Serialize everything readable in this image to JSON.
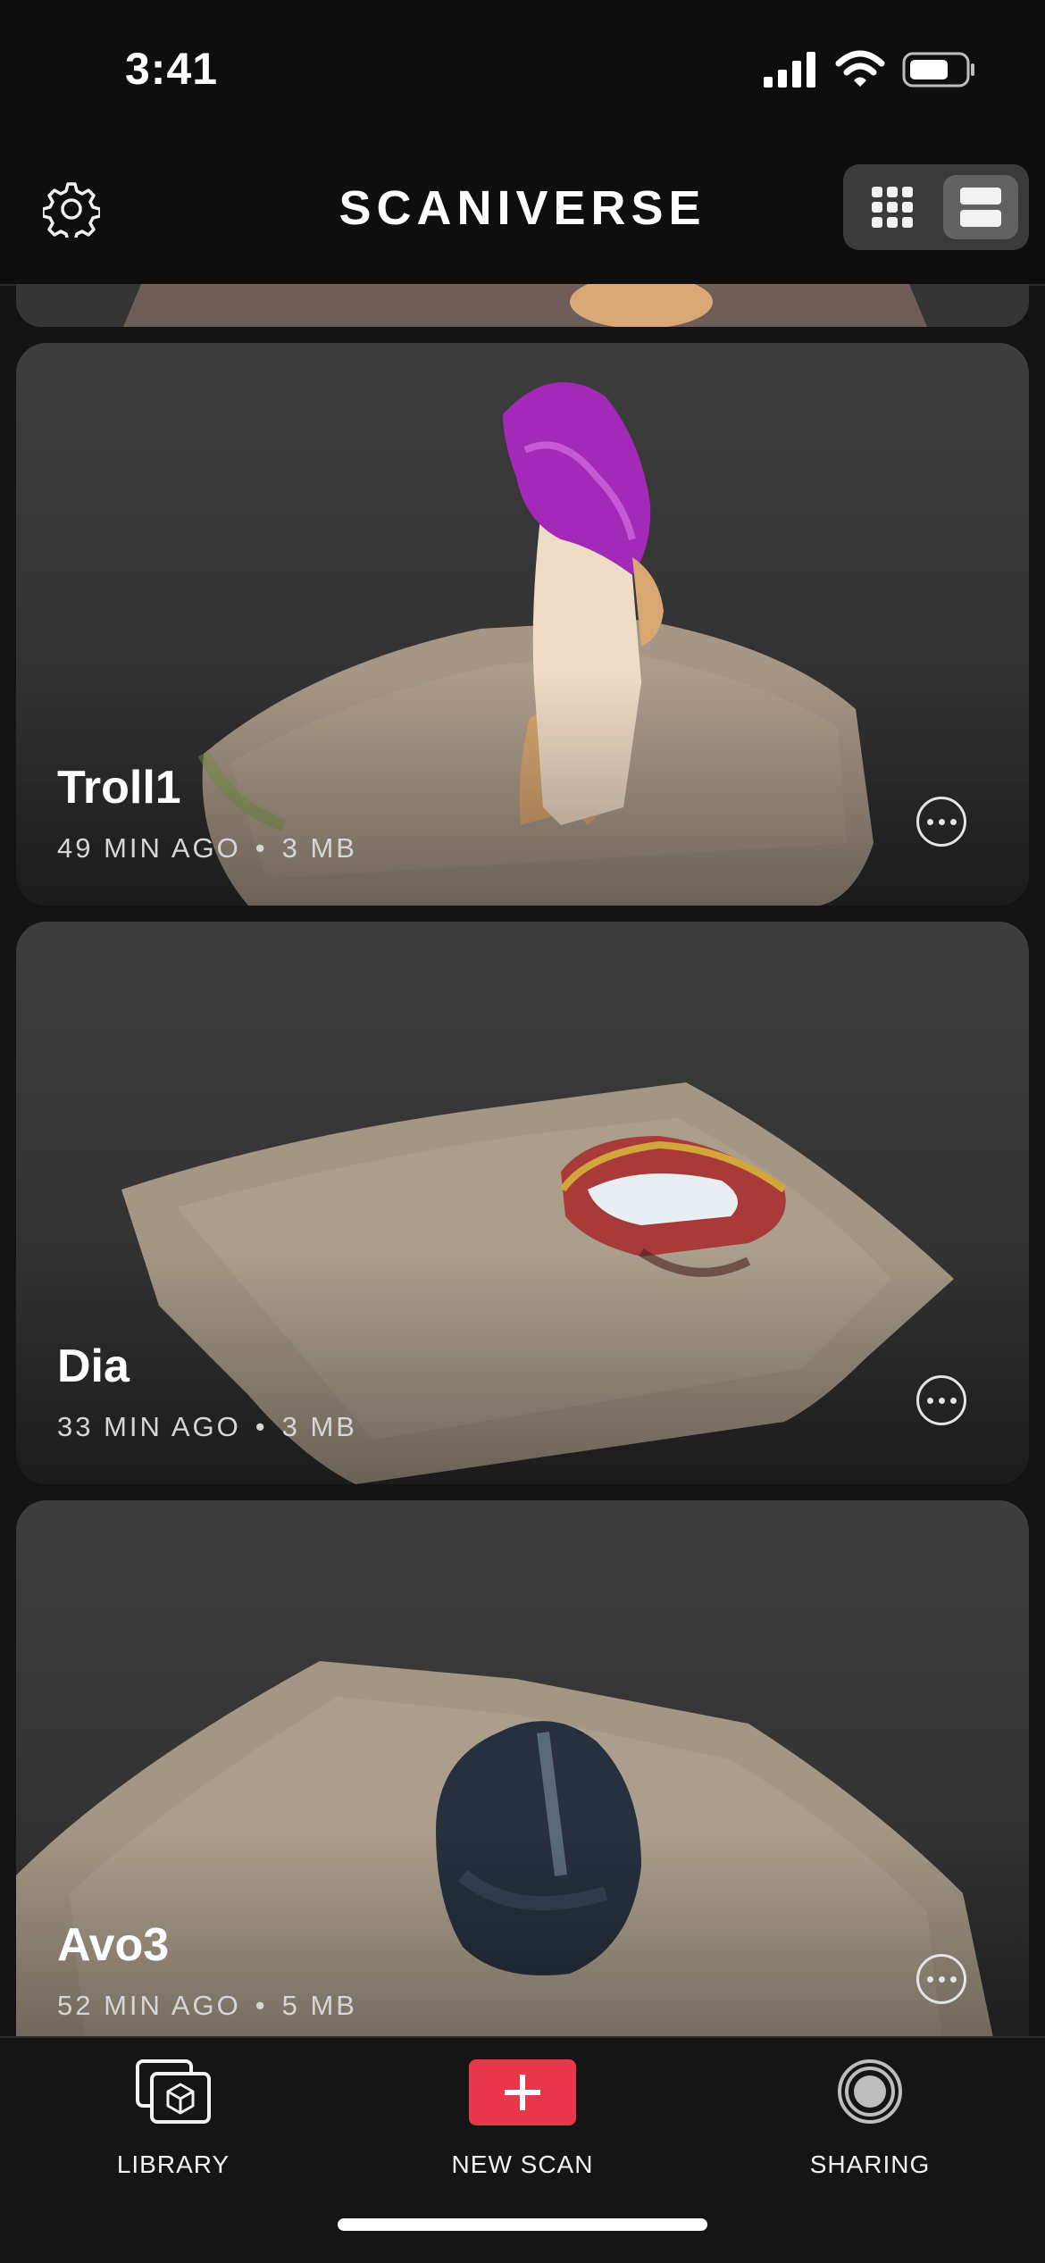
{
  "status_bar": {
    "time": "3:41"
  },
  "header": {
    "title": "SCANIVERSE"
  },
  "scans": [
    {
      "name": "Troll1",
      "age": "49 MIN AGO",
      "size": "3 MB"
    },
    {
      "name": "Dia",
      "age": "33 MIN AGO",
      "size": "3 MB"
    },
    {
      "name": "Avo3",
      "age": "52 MIN AGO",
      "size": "5 MB"
    }
  ],
  "meta_separator": "•",
  "tabs": {
    "library": "LIBRARY",
    "new_scan": "NEW SCAN",
    "sharing": "SHARING"
  },
  "colors": {
    "accent": "#e8364a",
    "background": "#131313",
    "card": "#3a3a3a"
  },
  "icons": [
    "gear-icon",
    "grid-view-icon",
    "list-view-icon",
    "more-icon",
    "library-icon",
    "plus-icon",
    "sharing-icon"
  ]
}
